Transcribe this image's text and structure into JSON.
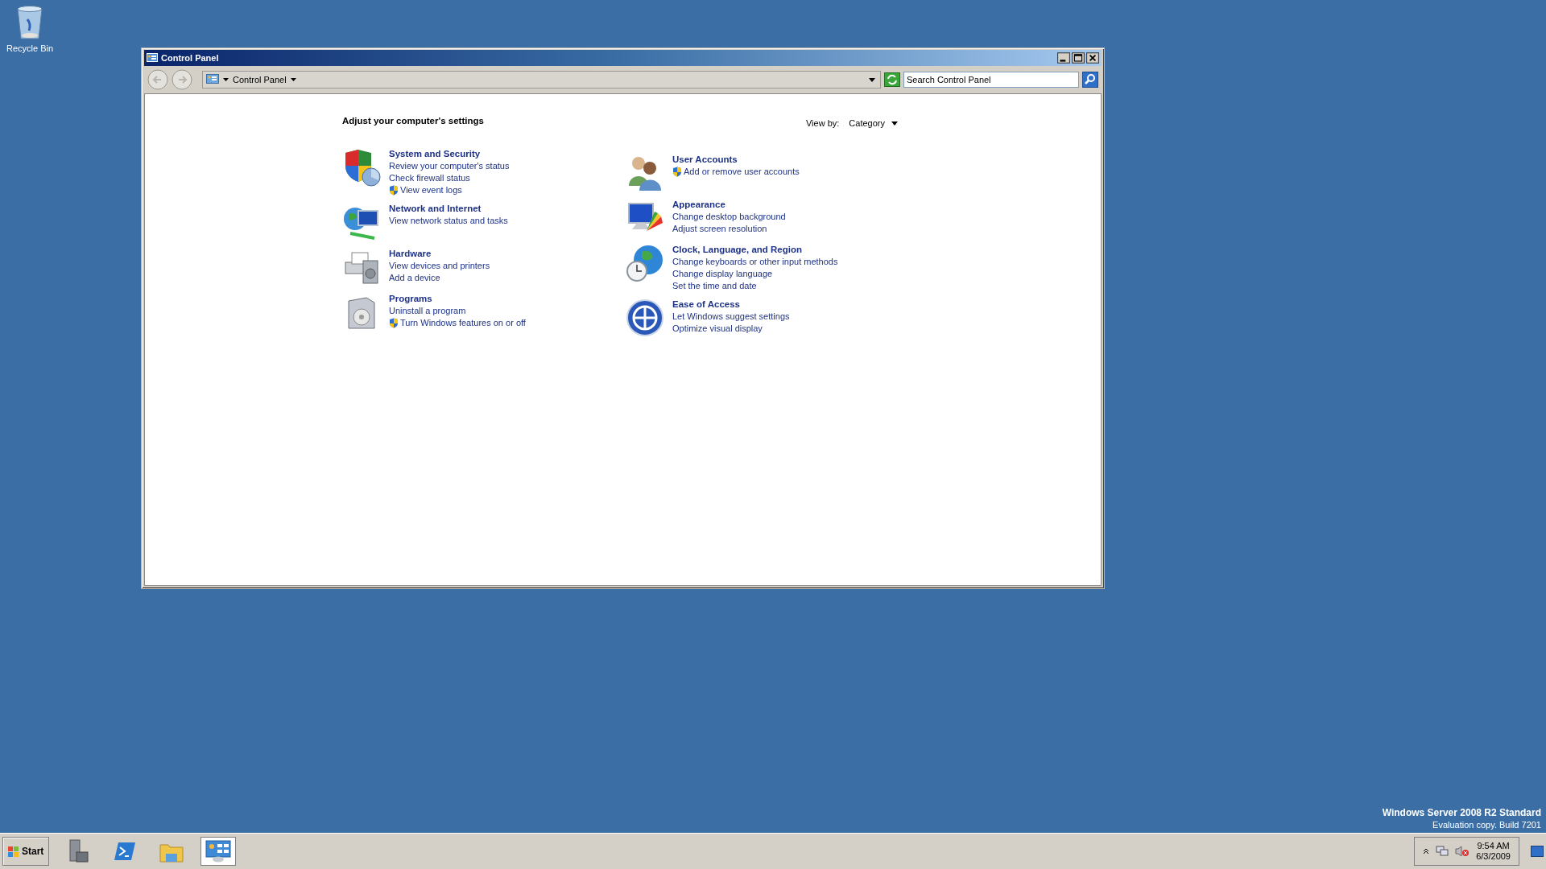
{
  "desktop_icons": [
    {
      "label": "Recycle Bin"
    }
  ],
  "window": {
    "title": "Control Panel",
    "address": "Control Panel",
    "search": {
      "placeholder": "Search Control Panel"
    },
    "heading": "Adjust your computer's settings",
    "view_by": {
      "label": "View by:",
      "value": "Category"
    },
    "columns": [
      [
        {
          "kind": "security",
          "title": "System and Security",
          "links": [
            {
              "text": "Review your computer's status",
              "shield": false
            },
            {
              "text": "Check firewall status",
              "shield": false
            },
            {
              "text": "View event logs",
              "shield": true
            }
          ]
        },
        {
          "kind": "network",
          "title": "Network and Internet",
          "links": [
            {
              "text": "View network status and tasks",
              "shield": false
            }
          ]
        },
        {
          "kind": "hardware",
          "title": "Hardware",
          "links": [
            {
              "text": "View devices and printers",
              "shield": false
            },
            {
              "text": "Add a device",
              "shield": false
            }
          ]
        },
        {
          "kind": "programs",
          "title": "Programs",
          "links": [
            {
              "text": "Uninstall a program",
              "shield": false
            },
            {
              "text": "Turn Windows features on or off",
              "shield": true
            }
          ]
        }
      ],
      [
        {
          "kind": "users",
          "title": "User Accounts",
          "links": [
            {
              "text": "Add or remove user accounts",
              "shield": true
            }
          ]
        },
        {
          "kind": "appearance",
          "title": "Appearance",
          "links": [
            {
              "text": "Change desktop background",
              "shield": false
            },
            {
              "text": "Adjust screen resolution",
              "shield": false
            }
          ]
        },
        {
          "kind": "clock",
          "title": "Clock, Language, and Region",
          "links": [
            {
              "text": "Change keyboards or other input methods",
              "shield": false
            },
            {
              "text": "Change display language",
              "shield": false
            },
            {
              "text": "Set the time and date",
              "shield": false
            }
          ]
        },
        {
          "kind": "ease",
          "title": "Ease of Access",
          "links": [
            {
              "text": "Let Windows suggest settings",
              "shield": false
            },
            {
              "text": "Optimize visual display",
              "shield": false
            }
          ]
        }
      ]
    ]
  },
  "edition": {
    "name": "Windows Server 2008 R2 Standard",
    "build": "Evaluation copy. Build 7201"
  },
  "taskbar": {
    "start": "Start",
    "pinned": [
      {
        "kind": "server",
        "selected": false
      },
      {
        "kind": "powershell",
        "selected": false
      },
      {
        "kind": "explorer",
        "selected": false
      },
      {
        "kind": "controlpanel",
        "selected": true
      }
    ],
    "clock": {
      "time": "9:54 AM",
      "date": "6/3/2009"
    }
  }
}
